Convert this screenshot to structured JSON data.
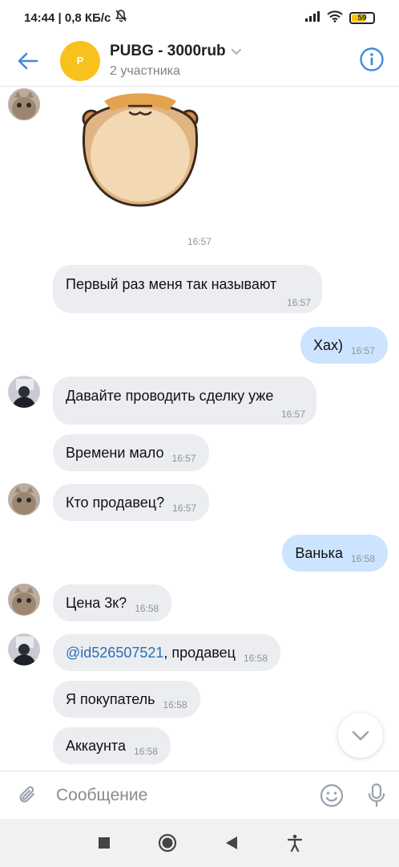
{
  "status_bar": {
    "time_speed": "14:44 | 0,8 КБ/с",
    "battery_level": "59"
  },
  "header": {
    "avatar_letter": "P",
    "avatar_color": "#f7c21d",
    "title": "PUBG - 3000rub",
    "subtitle": "2 участника",
    "accent_color": "#3f8ae0"
  },
  "messages": {
    "date_separator": "16:57",
    "items": [
      {
        "side": "in",
        "text": "Первый раз меня так называют",
        "time": "16:57"
      },
      {
        "side": "out",
        "text": "Хах)",
        "time": "16:57"
      },
      {
        "side": "in",
        "text": "Давайте проводить сделку уже",
        "time": "16:57"
      },
      {
        "side": "in",
        "text": "Времени мало",
        "time": "16:57"
      },
      {
        "side": "in",
        "text": "Кто продавец?",
        "time": "16:57"
      },
      {
        "side": "out",
        "text": "Ванька",
        "time": "16:58"
      },
      {
        "side": "in",
        "text": "Цена 3к?",
        "time": "16:58"
      },
      {
        "side": "in",
        "mention": "@id526507521",
        "text": ", продавец",
        "time": "16:58"
      },
      {
        "side": "in",
        "text": "Я покупатель",
        "time": "16:58"
      },
      {
        "side": "in",
        "text": "Аккаунта",
        "time": "16:58"
      }
    ]
  },
  "composer": {
    "placeholder": "Сообщение"
  }
}
